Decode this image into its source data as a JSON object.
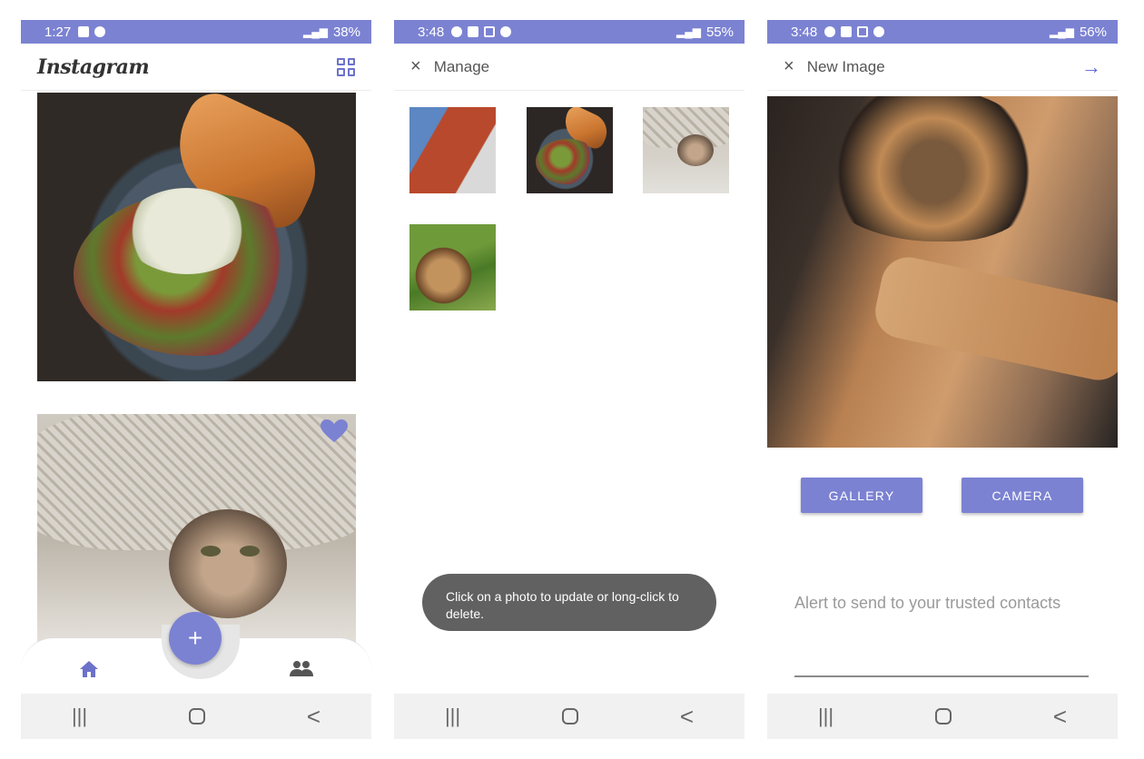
{
  "screens": [
    {
      "status": {
        "time": "1:27",
        "battery": "38%"
      },
      "appbar": {
        "logo": "Instagram"
      },
      "nav": {
        "recents": "|||",
        "back": "<"
      }
    },
    {
      "status": {
        "time": "3:48",
        "battery": "55%"
      },
      "appbar": {
        "title": "Manage"
      },
      "toast": "Click on a photo to update or long-click to delete.",
      "nav": {
        "recents": "|||",
        "back": "<"
      }
    },
    {
      "status": {
        "time": "3:48",
        "battery": "56%"
      },
      "appbar": {
        "title": "New Image"
      },
      "buttons": {
        "gallery": "GALLERY",
        "camera": "CAMERA"
      },
      "alert_placeholder": "Alert to send to your trusted contacts",
      "nav": {
        "recents": "|||",
        "back": "<"
      }
    }
  ],
  "icons": {
    "close": "close-icon",
    "next": "arrow-right-icon",
    "grid": "grid-icon",
    "home": "home-icon",
    "people": "people-icon",
    "heart": "heart-icon",
    "add": "plus-icon"
  },
  "colors": {
    "accent": "#7b82d2",
    "status_bar": "#7b82d2",
    "arrow": "#5b63d6"
  },
  "glyphs": {
    "close": "×",
    "plus": "+",
    "arrow": "→"
  }
}
